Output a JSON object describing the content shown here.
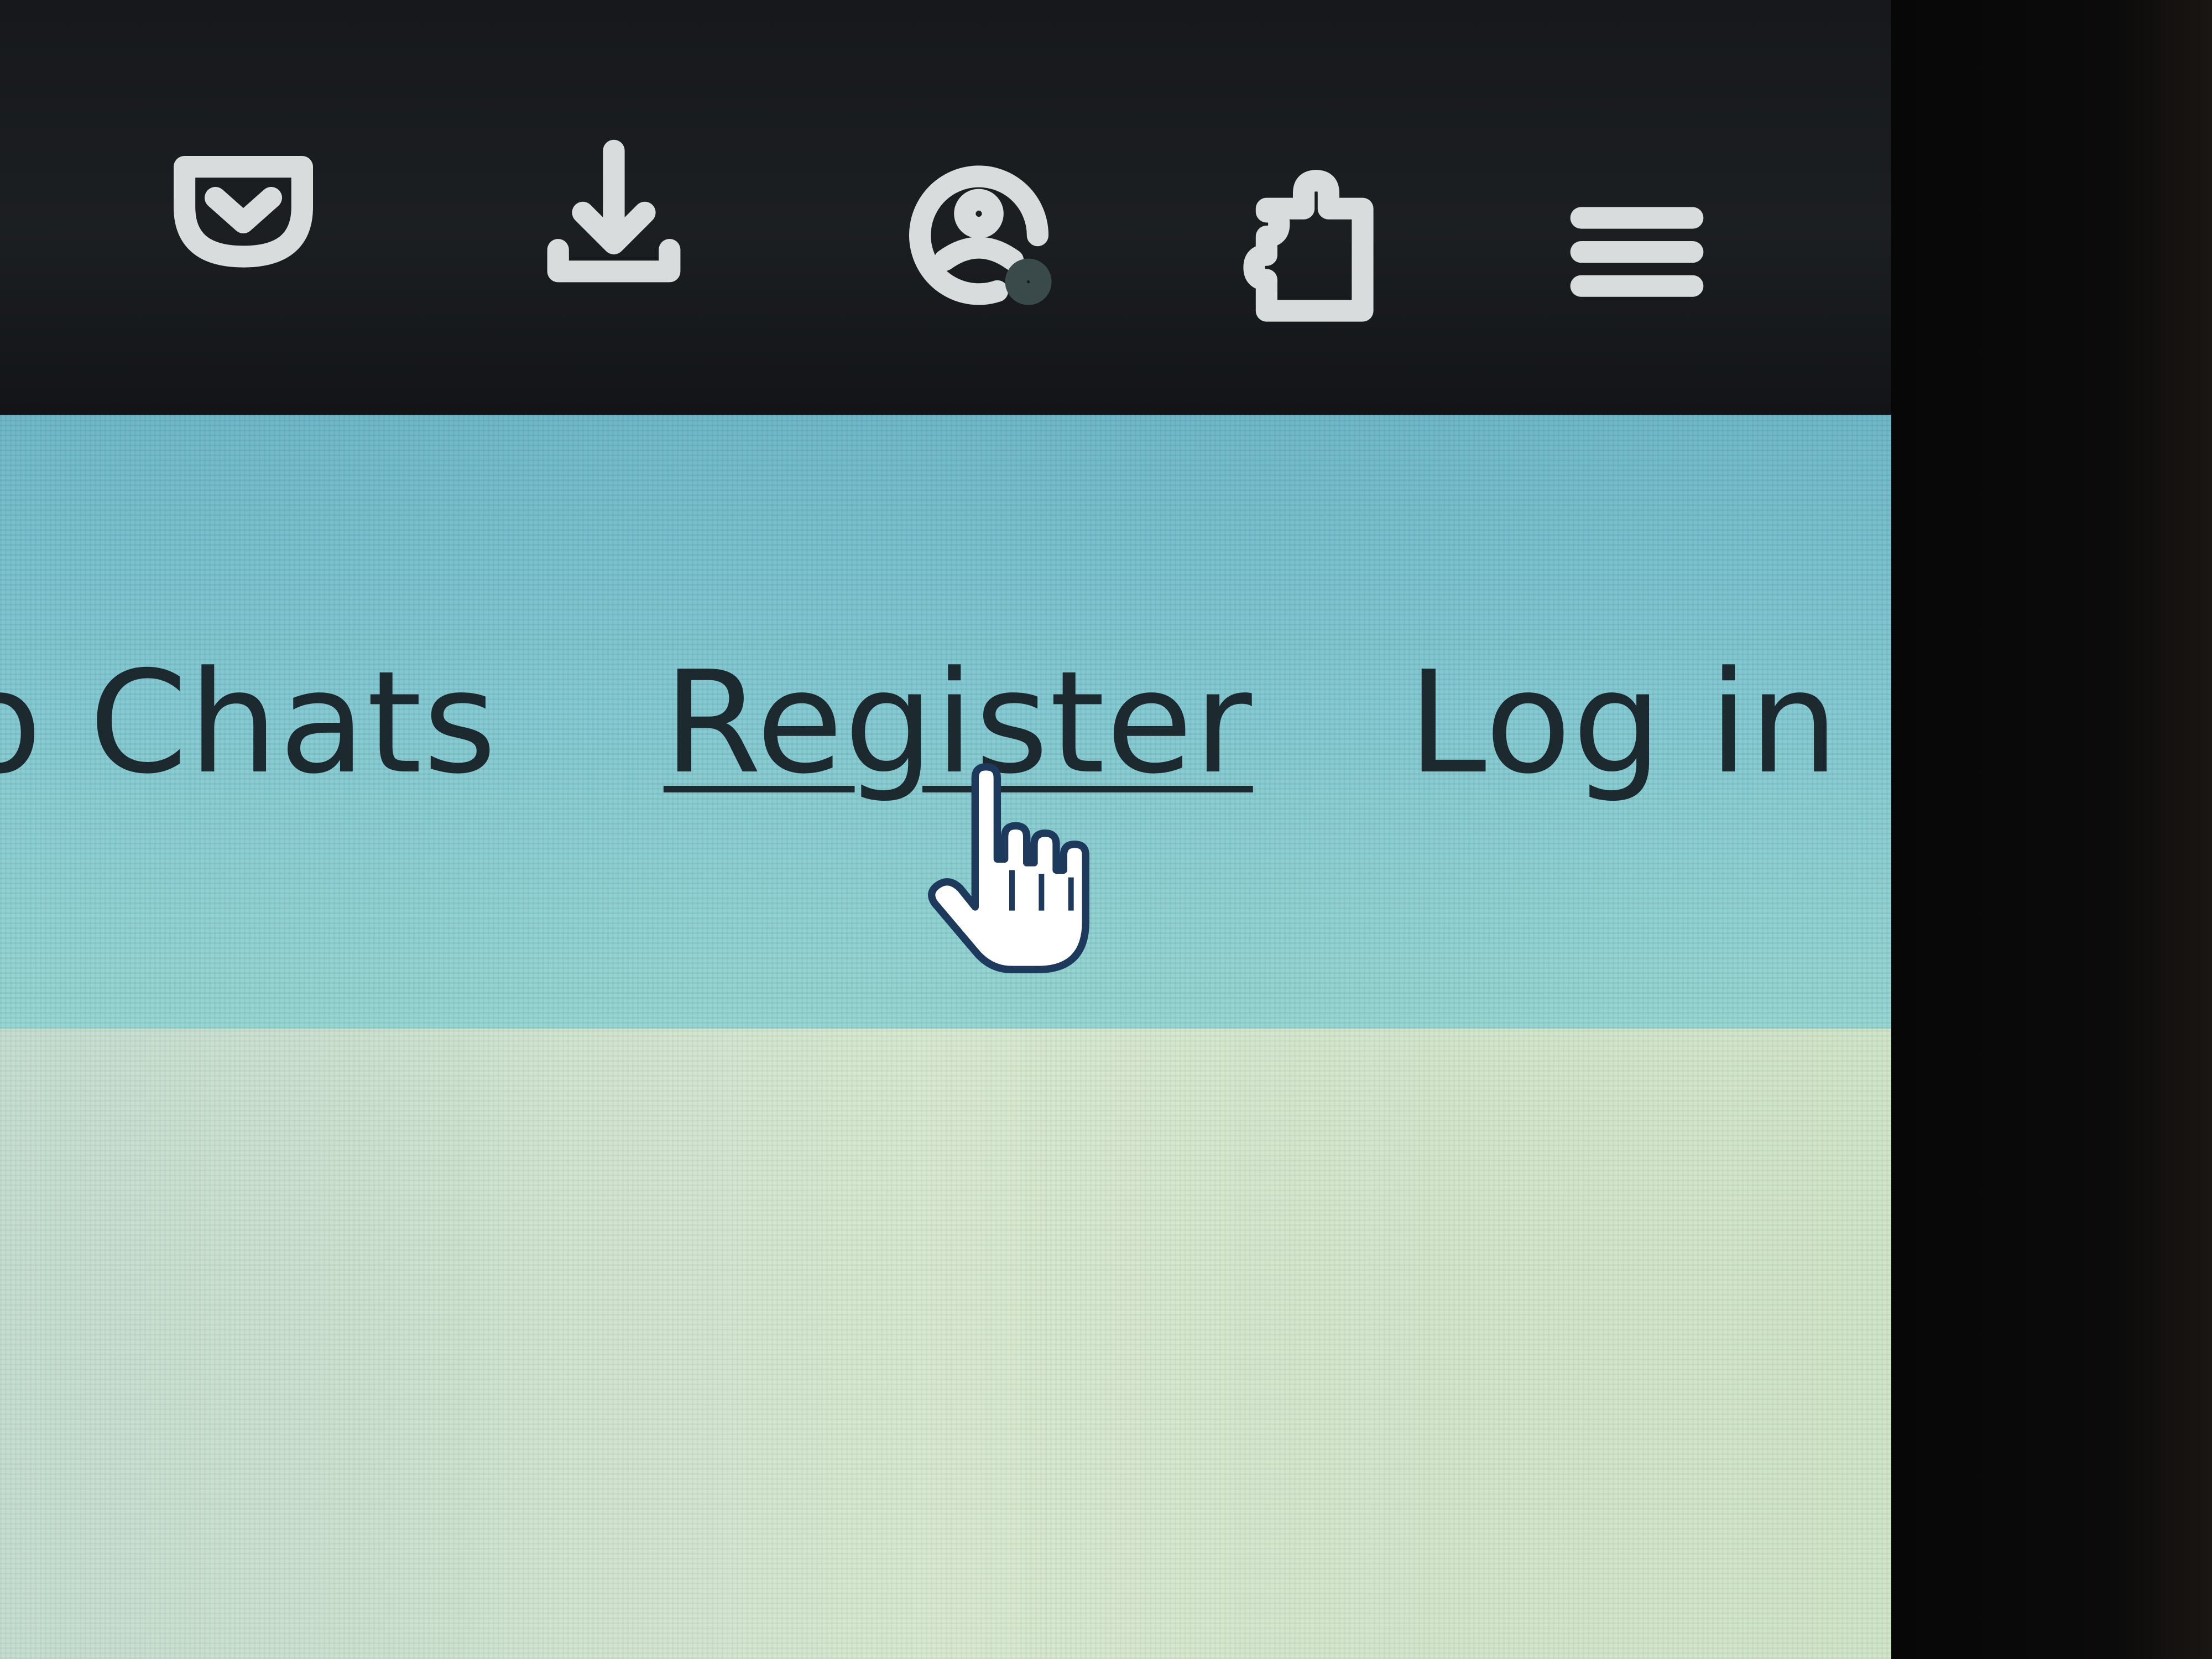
{
  "toolbar": {
    "buttons": [
      {
        "id": "pocket",
        "icon": "pocket-icon"
      },
      {
        "id": "downloads",
        "icon": "download-icon"
      },
      {
        "id": "account",
        "icon": "account-icon"
      },
      {
        "id": "extensions",
        "icon": "puzzle-icon"
      },
      {
        "id": "menu",
        "icon": "hamburger-menu-icon"
      }
    ],
    "background_color": "#1c1f22",
    "icon_color": "#d8dcdc"
  },
  "header": {
    "background_color": "#83c9d2",
    "nav": {
      "chats_label": "o Chats",
      "register_label": "Register",
      "login_label": "Log in"
    }
  },
  "page_body": {
    "background_color": "#d7e8cf"
  },
  "cursor": {
    "type": "hand-pointer-icon",
    "hovering": "Register"
  }
}
